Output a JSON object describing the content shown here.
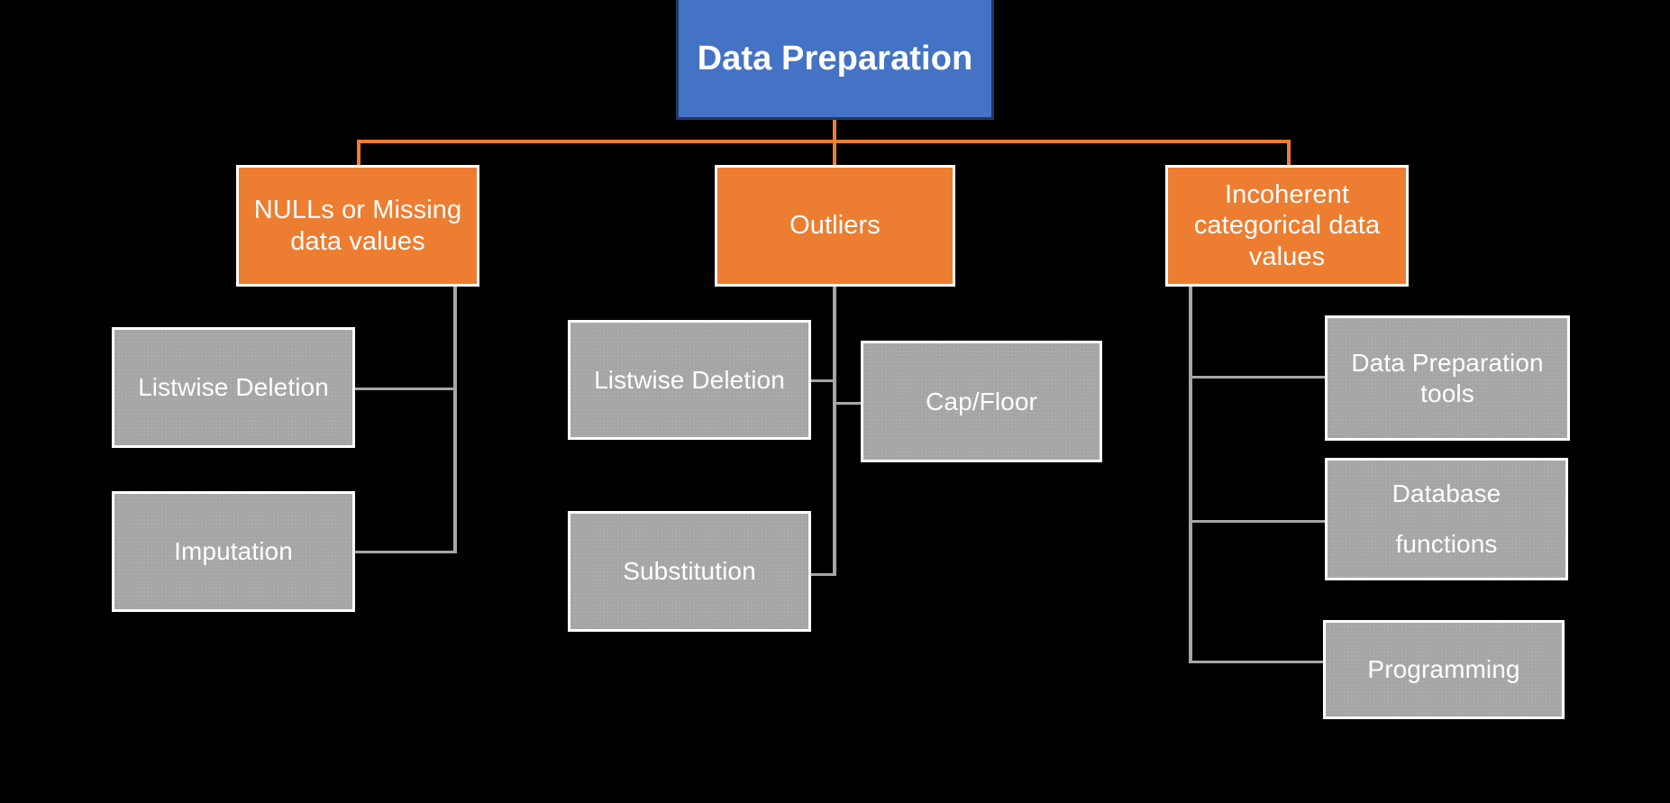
{
  "diagram": {
    "title": "Data Preparation",
    "background_color": "#000000",
    "palette": {
      "root_fill": "#4472C4",
      "root_border": "#1F3864",
      "category_fill": "#ED7D31",
      "leaf_fill": "#A5A5A5",
      "box_border": "#FFFFFF",
      "connector_gray": "#A6A6A6",
      "connector_orange": "#ED7D31",
      "text": "#FFFFFF"
    },
    "root": {
      "label": "Data Preparation"
    },
    "categories": [
      {
        "id": "nulls",
        "label": "NULLs or Missing\ndata values",
        "children": [
          {
            "id": "nulls-listwise-deletion",
            "label": "Listwise Deletion"
          },
          {
            "id": "nulls-imputation",
            "label": "Imputation"
          }
        ]
      },
      {
        "id": "outliers",
        "label": "Outliers",
        "children": [
          {
            "id": "outliers-listwise-deletion",
            "label": "Listwise Deletion"
          },
          {
            "id": "outliers-cap-floor",
            "label": "Cap/Floor"
          },
          {
            "id": "outliers-substitution",
            "label": "Substitution"
          }
        ]
      },
      {
        "id": "incoherent",
        "label": "Incoherent\ncategorical data\nvalues",
        "children": [
          {
            "id": "incoherent-data-prep-tools",
            "label": "Data Preparation\ntools"
          },
          {
            "id": "incoherent-database-functions",
            "label": "Database\nfunctions"
          },
          {
            "id": "incoherent-programming",
            "label": "Programming"
          }
        ]
      }
    ]
  }
}
